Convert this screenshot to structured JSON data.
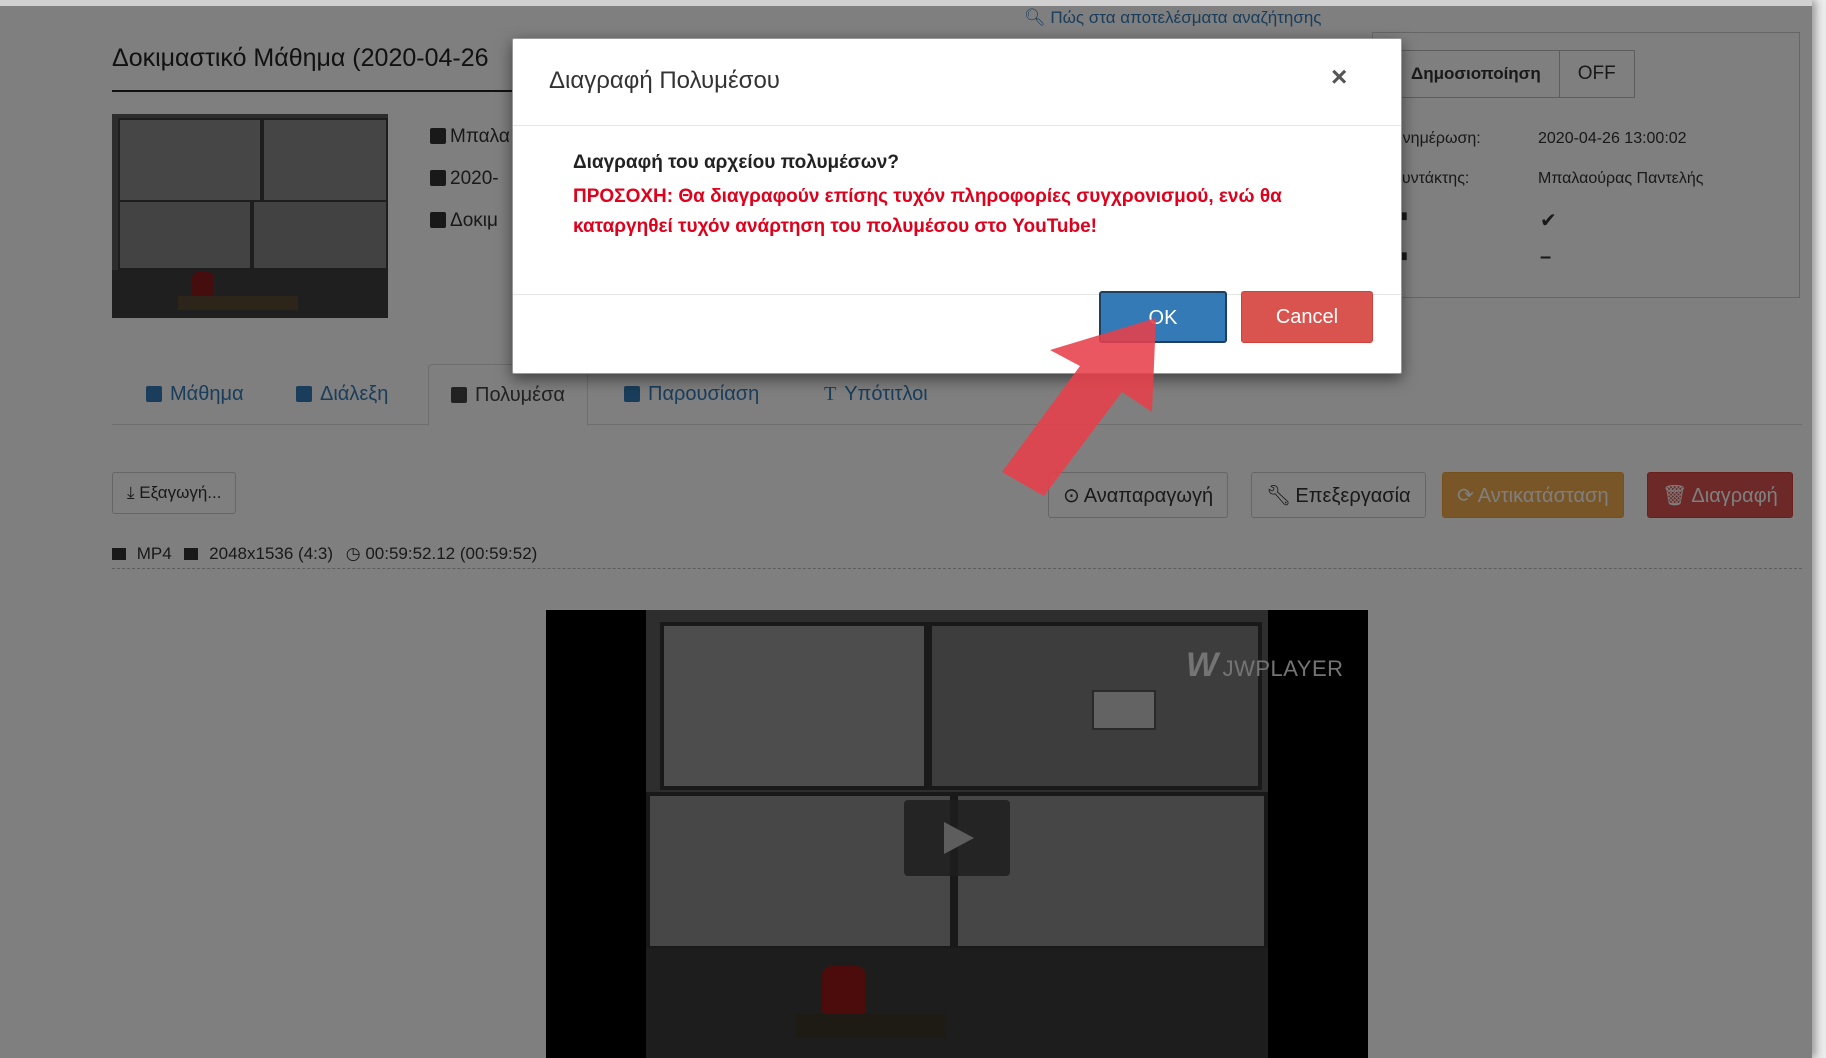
{
  "page": {
    "top_link": "Πώς στα αποτελέσματα αναζήτησης",
    "title": "Δοκιμαστικό Μάθημα (2020-04-26",
    "meta": {
      "author": "Μπαλα",
      "date": "2020-",
      "course": "Δοκιμ"
    },
    "info": {
      "publish_label": "Δημοσιοποίηση",
      "publish_state": "OFF",
      "updated_label": "Ενημέρωση:",
      "updated_value": "2020-04-26 13:00:02",
      "editor_label": "Συντάκτης:",
      "editor_value": "Μπαλαούρας Παντελής",
      "video_value": "✔",
      "presentation_value": "–"
    },
    "tabs": [
      {
        "label": "Μάθημα",
        "icon": "book-icon"
      },
      {
        "label": "Διάλεξη",
        "icon": "comment-icon"
      },
      {
        "label": "Πολυμέσα",
        "icon": "video-camera-icon"
      },
      {
        "label": "Παρουσίαση",
        "icon": "presentation-icon"
      },
      {
        "label": "Υπότιτλοι",
        "icon": "text-icon"
      }
    ],
    "toolbar": {
      "export": "Εξαγωγή...",
      "play": "Αναπαραγωγή",
      "edit": "Επεξεργασία",
      "replace": "Αντικατάσταση",
      "delete": "Διαγραφή"
    },
    "media_info": {
      "format": "MP4",
      "resolution": "2048x1536 (4:3)",
      "duration": "00:59:52.12 (00:59:52)"
    },
    "player": {
      "brand": "JWPLAYER"
    }
  },
  "modal": {
    "title": "Διαγραφή Πολυμέσου",
    "close": "×",
    "question": "Διαγραφή του αρχείου πολυμέσων?",
    "warning": "ΠΡΟΣΟΧΗ: Θα διαγραφούν επίσης τυχόν πληροφορίες συγχρονισμού, ενώ θα καταργηθεί τυχόν ανάρτηση του πολυμέσου στο YouTube!",
    "ok": "OK",
    "cancel": "Cancel"
  },
  "colors": {
    "link": "#337ab7",
    "warning_text": "#e0001b",
    "danger": "#d9534f",
    "warning_btn": "#f0ad4e",
    "annotation_arrow": "#e8404a"
  }
}
